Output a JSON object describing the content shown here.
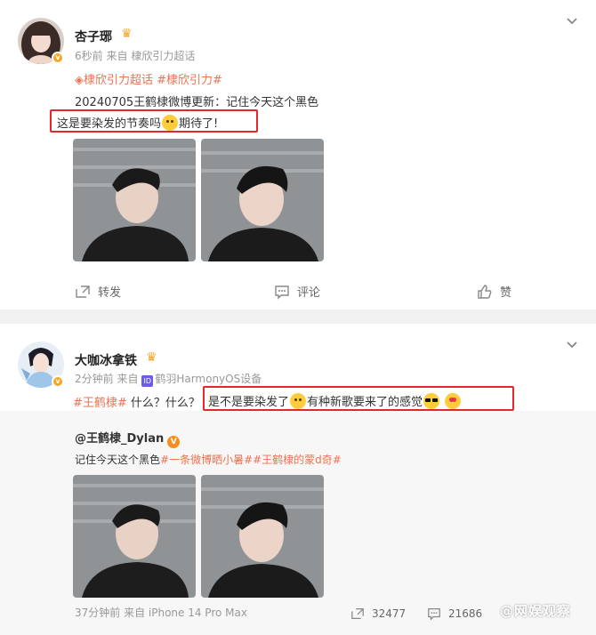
{
  "post1": {
    "username": "杏子琊",
    "time": "6秒前",
    "source_prefix": "来自",
    "source": "棣欣引力超话",
    "topics": "棣欣引力超话 #棣欣引力#",
    "line1": "20240705王鹤棣微博更新：记住今天这个黑色",
    "line2a": "这是要染发的节奏吗",
    "line2b": "期待了!",
    "actions": {
      "repost": "转发",
      "comment": "评论",
      "like": "赞"
    }
  },
  "post2": {
    "username": "大咖冰拿铁",
    "time": "2分钟前",
    "source_prefix": "来自",
    "device_icon": "ID",
    "source": "鹤羽HarmonyOS设备",
    "topic": "#王鹤棣#",
    "plain": " 什么？什么？",
    "hl_a": "是不是要染发了",
    "hl_b": "有种新歌要来了的感觉",
    "repost": {
      "user": "@王鹤棣_Dylan",
      "badge": "V",
      "text": "记住今天这个黑色",
      "tags": "#一条微博晒小暑##王鹤棣的蒙d奇#",
      "meta": "37分钟前 来自 iPhone 14 Pro Max",
      "reposts": "32477",
      "comments": "21686"
    }
  },
  "watermark": "@网娱观察",
  "colors": {
    "topic": "#eb7350",
    "highlight": "#e5262c",
    "badge": "#f6a623"
  }
}
